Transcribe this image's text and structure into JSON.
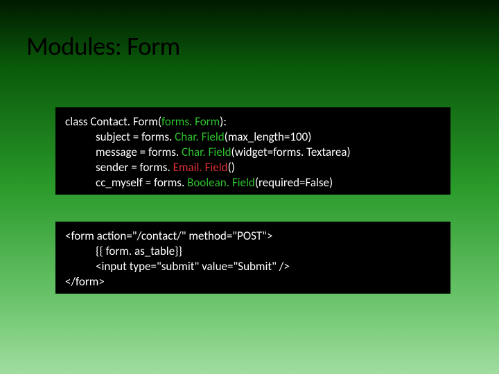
{
  "slide": {
    "title": "Modules: Form"
  },
  "code_top": {
    "l1a": "class",
    "l1b": " Contact. Form(",
    "l1c": "forms. Form",
    "l1d": "):",
    "l2a": "subject = forms. ",
    "l2b": "Char. Field",
    "l2c": "(max_length=100)",
    "l3a": "message = forms. ",
    "l3b": "Char. Field",
    "l3c": "(widget=forms. Textarea)",
    "l4a": "sender = forms. ",
    "l4b": "Email. Field",
    "l4c": "()",
    "l5a": "cc_myself = forms. ",
    "l5b": "Boolean. Field",
    "l5c": "(required=False)"
  },
  "code_bottom": {
    "l1": "<form action=\"/contact/\" method=\"POST\">",
    "l2": "{{ form. as_table}}",
    "l3": "<input type=\"submit\" value=\"Submit\" />",
    "l4": "</form>"
  }
}
